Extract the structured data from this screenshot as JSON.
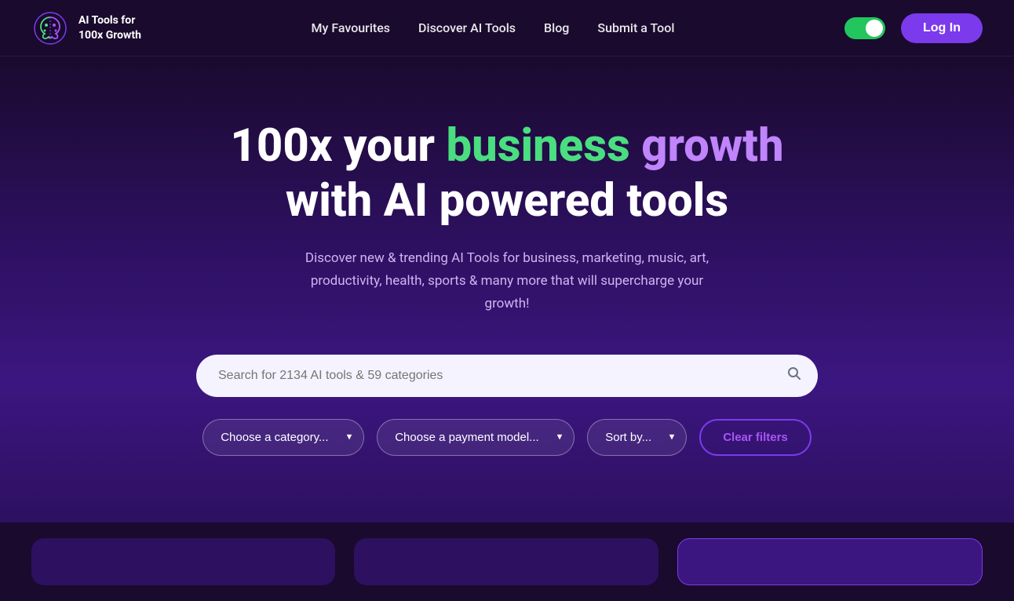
{
  "navbar": {
    "logo_text": "AI Tools for\n100x Growth",
    "links": [
      {
        "label": "My Favourites",
        "id": "my-favourites"
      },
      {
        "label": "Discover AI Tools",
        "id": "discover-ai-tools"
      },
      {
        "label": "Blog",
        "id": "blog"
      },
      {
        "label": "Submit a Tool",
        "id": "submit-a-tool"
      }
    ],
    "login_label": "Log In",
    "toggle_on": true
  },
  "hero": {
    "title_part1": "100x your ",
    "title_highlight_green": "business",
    "title_part2": " ",
    "title_highlight_purple": "growth",
    "title_line2": "with AI powered tools",
    "subtitle": "Discover new & trending AI Tools for business, marketing, music, art, productivity, health, sports & many more that will supercharge your growth!",
    "search_placeholder": "Search for 2134 AI tools & 59 categories",
    "category_placeholder": "Choose a category...",
    "payment_placeholder": "Choose a payment model...",
    "sort_placeholder": "Sort by...",
    "clear_filters_label": "Clear filters"
  }
}
